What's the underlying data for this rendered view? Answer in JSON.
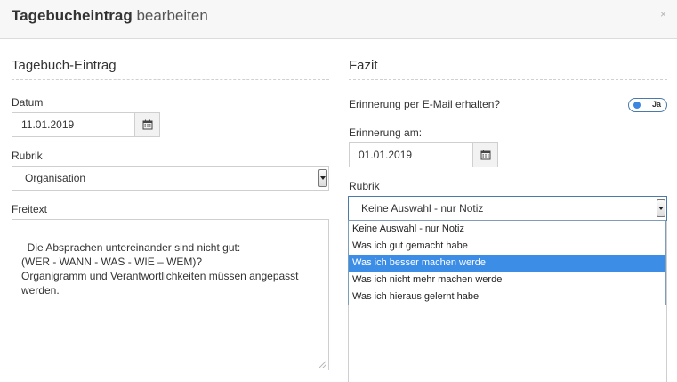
{
  "header": {
    "title_bold": "Tagebucheintrag",
    "title_light": "bearbeiten",
    "close_label": "×"
  },
  "left": {
    "section_title": "Tagebuch-Eintrag",
    "date_label": "Datum",
    "date_value": "11.01.2019",
    "rubrik_label": "Rubrik",
    "rubrik_value": "Organisation",
    "freitext_label": "Freitext",
    "freitext_value": "Die Absprachen untereinander sind nicht gut:\n(WER - WANN - WAS - WIE – WEM)?\nOrganigramm und Verantwortlichkeiten müssen angepasst\nwerden."
  },
  "right": {
    "section_title": "Fazit",
    "reminder_label": "Erinnerung per E-Mail erhalten?",
    "reminder_toggle_label": "Ja",
    "reminder_date_label": "Erinnerung am:",
    "reminder_date_value": "01.01.2019",
    "rubrik_label": "Rubrik",
    "rubrik_value": "Keine Auswahl - nur Notiz",
    "options": [
      "Keine Auswahl - nur Notiz",
      "Was ich gut gemacht habe",
      "Was ich besser machen werde",
      "Was ich nicht mehr machen werde",
      "Was ich hieraus gelernt habe"
    ],
    "highlighted_option": "Was ich besser machen werde"
  },
  "icons": {
    "calendar": "calendar-icon",
    "close": "close-icon",
    "dropdown": "chevron-down-icon"
  },
  "colors": {
    "accent": "#3c8de6",
    "header_bg": "#f7f7f7",
    "border": "#cfcfcf"
  }
}
